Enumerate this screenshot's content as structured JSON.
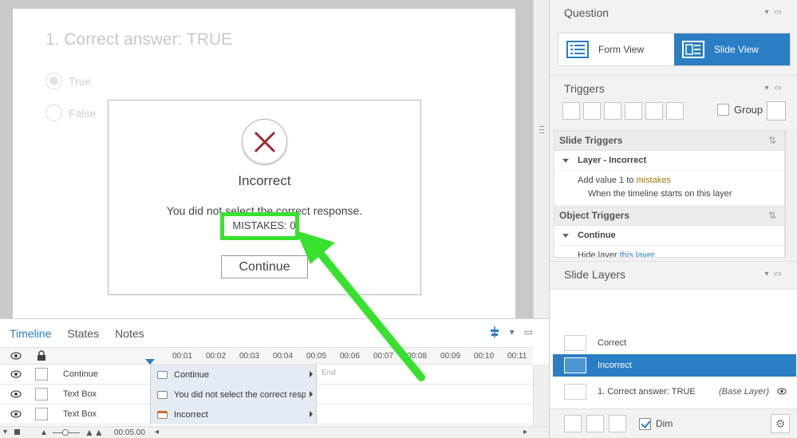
{
  "slide": {
    "title": "1. Correct answer: TRUE",
    "options": [
      "True",
      "False"
    ],
    "feedback": {
      "title": "Incorrect",
      "message": "You did not select the correct response.",
      "mistakes": "MISTAKES: 0",
      "continue": "Continue"
    }
  },
  "timeline": {
    "tabs": [
      "Timeline",
      "States",
      "Notes"
    ],
    "ticks": [
      "00:01",
      "00:02",
      "00:03",
      "00:04",
      "00:05",
      "00:06",
      "00:07",
      "00:08",
      "00:09",
      "00:10",
      "00:11"
    ],
    "end_label": "End",
    "rows": [
      {
        "name": "Continue",
        "bar": "Continue"
      },
      {
        "name": "Text Box",
        "bar": "You did not select the correct resp..."
      },
      {
        "name": "Text Box",
        "bar": "Incorrect"
      }
    ],
    "duration": "00:05.00"
  },
  "question_panel": {
    "title": "Question",
    "form_view": "Form View",
    "slide_view": "Slide View"
  },
  "triggers_panel": {
    "title": "Triggers",
    "group_label": "Group",
    "slide_triggers": "Slide Triggers",
    "layer_incorrect": "Layer - Incorrect",
    "action_add": "Add value",
    "action_value": "1",
    "action_to": "to",
    "action_var": "mistakes",
    "cond_when": "When the",
    "cond_timeline": "timeline",
    "cond_starts": "starts",
    "cond_on": "on",
    "cond_layer": "this layer",
    "object_triggers": "Object Triggers",
    "continue_item": "Continue",
    "hide_action": "Hide layer",
    "hide_target": "this layer"
  },
  "layers_panel": {
    "title": "Slide Layers",
    "layers": [
      "Correct",
      "Incorrect",
      "1. Correct answer: TRUE"
    ],
    "base_tag": "(Base Layer)",
    "dim_label": "Dim"
  },
  "colors": {
    "accent": "#2a7ec4",
    "highlight": "#39e12f",
    "x_mark": "#9e2a2f"
  }
}
